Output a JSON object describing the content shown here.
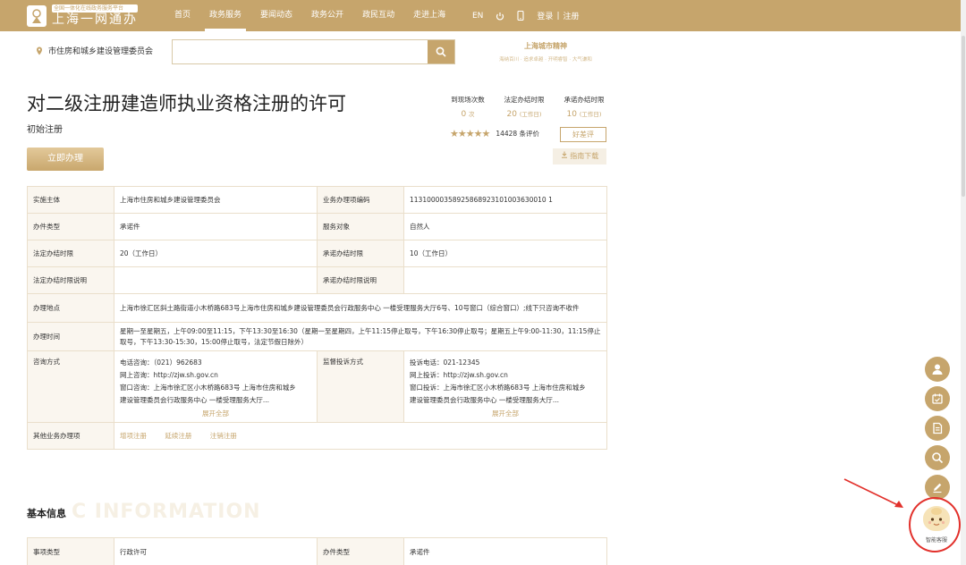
{
  "header": {
    "slogan": "全国一体化在线政务服务平台",
    "brand": "上海一网通办",
    "nav": [
      "首页",
      "政务服务",
      "要闻动态",
      "政务公开",
      "政民互动",
      "走进上海"
    ],
    "active_nav": "政务服务",
    "lang": "EN",
    "login": "登录",
    "register": "注册",
    "divider": "|"
  },
  "search": {
    "location": "市住房和城乡建设管理委员会",
    "placeholder": "",
    "city_spirit_title": "上海城市精神",
    "city_spirit_sub": "海纳百川 · 追求卓越 · 开明睿智 · 大气谦和"
  },
  "item": {
    "title": "对二级注册建造师执业资格注册的许可",
    "subtitle": "初始注册",
    "apply": "立即办理",
    "stats": [
      {
        "label": "到现场次数",
        "value": "0",
        "unit": "次"
      },
      {
        "label": "法定办结时限",
        "value": "20",
        "unit": "(工作日)"
      },
      {
        "label": "承诺办结时限",
        "value": "10",
        "unit": "(工作日)"
      }
    ],
    "stars": "★★★★★",
    "rating_count": "14428 条评价",
    "review": "好差评",
    "guide_download": "指南下载"
  },
  "table": {
    "impl_label": "实施主体",
    "impl_value": "上海市住房和城乡建设管理委员会",
    "code_label": "业务办理项编码",
    "code_value": "11310000358925868923101003630010 1",
    "type_label": "办件类型",
    "type_value": "承诺件",
    "target_label": "服务对象",
    "target_value": "自然人",
    "legal_label": "法定办结时限",
    "legal_value": "20（工作日）",
    "promise_label": "承诺办结时限",
    "promise_value": "10（工作日）",
    "legal_note_label": "法定办结时限说明",
    "legal_note_value": "",
    "promise_note_label": "承诺办结时限说明",
    "promise_note_value": "",
    "place_label": "办理地点",
    "place_value": "上海市徐汇区斜土路街道小木桥路683号上海市住房和城乡建设管理委员会行政服务中心 一楼受理服务大厅6号、10号窗口（综合窗口）;线下只咨询不收件",
    "time_label": "办理时间",
    "time_value": "星期一至星期五，上午09:00至11:15，下午13:30至16:30（星期一至星期四，上午11:15停止取号，下午16:30停止取号；星期五上午9:00-11:30，11:15停止取号，下午13:30-15:30，15:00停止取号，法定节假日除外）",
    "consult_label": "咨询方式",
    "consult_lines": [
      "电话咨询：（021）962683",
      "网上咨询：http://zjw.sh.gov.cn",
      "窗口咨询：上海市徐汇区小木桥路683号 上海市住房和城乡",
      "建设管理委员会行政服务中心 一楼受理服务大厅..."
    ],
    "complaint_label": "监督投诉方式",
    "complaint_lines": [
      "投诉电话：021-12345",
      "网上投诉：http://zjw.sh.gov.cn",
      "窗口投诉：上海市徐汇区小木桥路683号 上海市住房和城乡",
      "建设管理委员会行政服务中心 一楼受理服务大厅..."
    ],
    "expand": "展开全部",
    "other_label": "其他业务办理项",
    "other_links": [
      "增项注册",
      "延续注册",
      "注销注册"
    ]
  },
  "basic": {
    "title": "基本信息",
    "bg_text": "C INFORMATION",
    "matter_label": "事项类型",
    "matter_value": "行政许可",
    "type_label": "办件类型",
    "type_value": "承诺件"
  },
  "assistant": {
    "label": "智能客服"
  },
  "colors": {
    "brand": "#c6a56c",
    "highlight": "#e2302b"
  }
}
